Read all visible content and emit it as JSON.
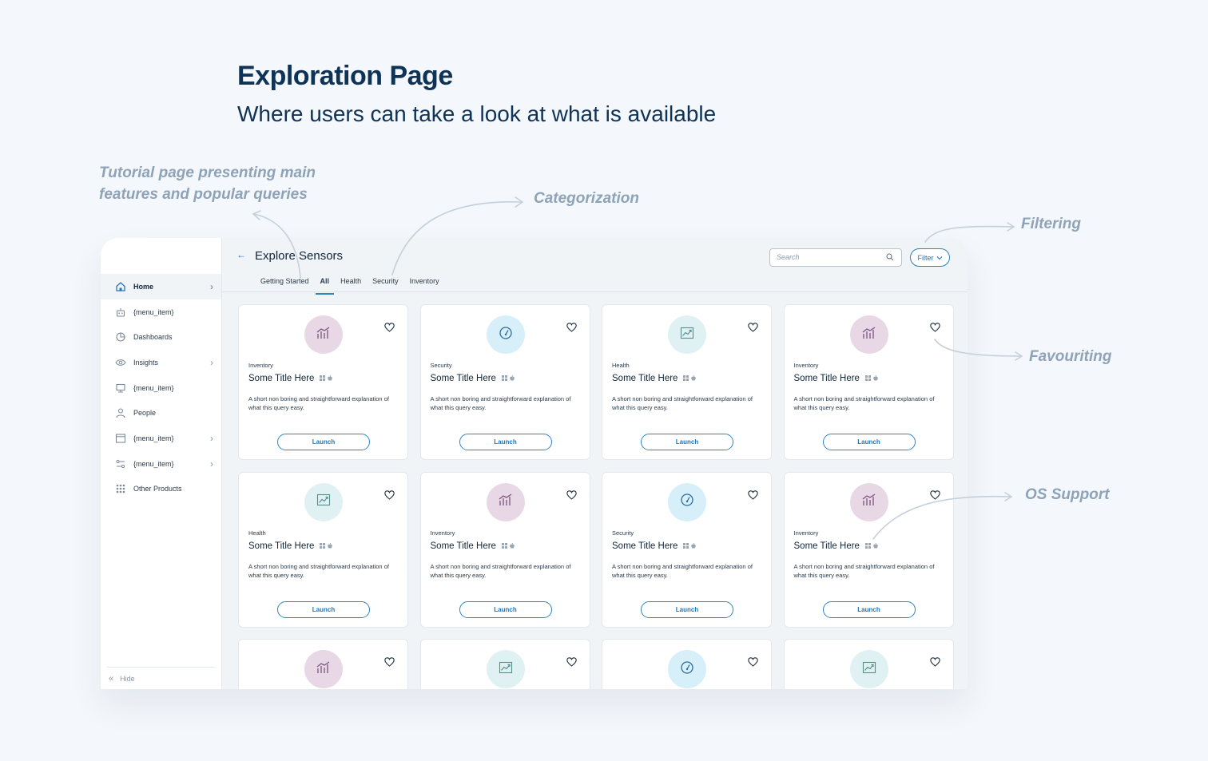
{
  "hero": {
    "title": "Exploration Page",
    "subtitle": "Where users can take a look at what is available"
  },
  "annotations": {
    "tutorial": "Tutorial page presenting main features and popular queries",
    "categorization": "Categorization",
    "filtering": "Filtering",
    "favouriting": "Favouriting",
    "os_support": "OS Support"
  },
  "sidebar": {
    "items": [
      {
        "label": "Home",
        "icon": "home-icon",
        "chevron": true,
        "active": true
      },
      {
        "label": "{menu_item}",
        "icon": "robot-icon",
        "chevron": false
      },
      {
        "label": "Dashboards",
        "icon": "pie-chart-icon",
        "chevron": false
      },
      {
        "label": "Insights",
        "icon": "eye-icon",
        "chevron": true
      },
      {
        "label": "{menu_item}",
        "icon": "monitor-icon",
        "chevron": false
      },
      {
        "label": "People",
        "icon": "person-icon",
        "chevron": false
      },
      {
        "label": "{menu_item}",
        "icon": "window-icon",
        "chevron": true
      },
      {
        "label": "{menu_item}",
        "icon": "settings-sliders-icon",
        "chevron": true
      },
      {
        "label": "Other Products",
        "icon": "apps-grid-icon",
        "chevron": false
      }
    ],
    "hide_label": "Hide"
  },
  "header": {
    "title": "Explore Sensors",
    "search_placeholder": "Search",
    "filter_label": "Filter"
  },
  "tabs": [
    {
      "label": "Getting Started",
      "active": false
    },
    {
      "label": "All",
      "active": true
    },
    {
      "label": "Health",
      "active": false
    },
    {
      "label": "Security",
      "active": false
    },
    {
      "label": "Inventory",
      "active": false
    }
  ],
  "card_text": {
    "title": "Some Title Here",
    "description": "A short non boring and straightforward explanation of what this query easy.",
    "launch_label": "Launch"
  },
  "cards": [
    {
      "category": "Inventory",
      "icon": "bar-chart-icon"
    },
    {
      "category": "Security",
      "icon": "gauge-icon"
    },
    {
      "category": "Health",
      "icon": "trend-chart-icon"
    },
    {
      "category": "Inventory",
      "icon": "bar-chart-icon"
    },
    {
      "category": "Health",
      "icon": "trend-chart-icon"
    },
    {
      "category": "Inventory",
      "icon": "bar-chart-icon"
    },
    {
      "category": "Security",
      "icon": "gauge-icon"
    },
    {
      "category": "Inventory",
      "icon": "bar-chart-icon"
    },
    {
      "category": "",
      "icon": "bar-chart-icon"
    },
    {
      "category": "",
      "icon": "trend-chart-icon"
    },
    {
      "category": "",
      "icon": "gauge-icon"
    },
    {
      "category": "",
      "icon": "trend-chart-icon"
    }
  ],
  "colors": {
    "accent": "#2b86c5",
    "inventory_badge": "#e8d8e6",
    "security_badge": "#d6eff8",
    "health_badge": "#dff1f2"
  }
}
